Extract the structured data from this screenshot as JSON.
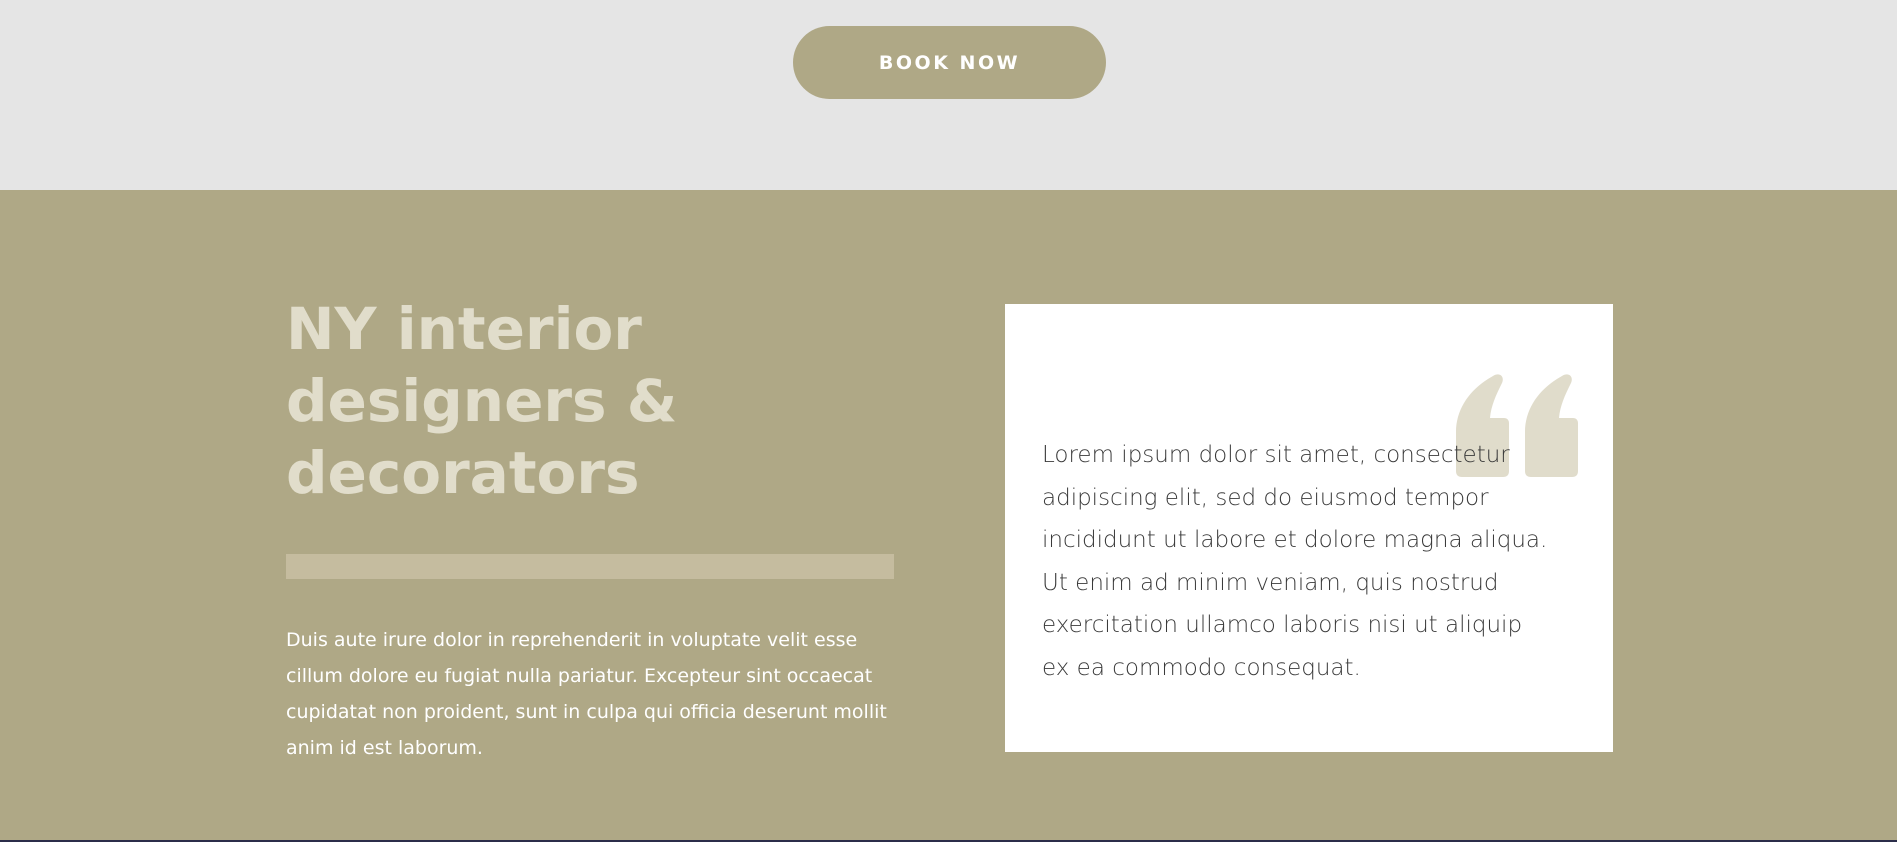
{
  "hero": {
    "book_label": "BOOK NOW"
  },
  "about": {
    "headline_lines": [
      "NY interior",
      "designers &",
      "decorators"
    ],
    "body_lines": [
      "Duis aute irure dolor in reprehenderit in voluptate velit esse",
      "cillum dolore eu fugiat nulla pariatur. Excepteur sint occaecat",
      "cupidatat non proident, sunt in culpa qui officia deserunt mollit",
      "anim id est laborum."
    ]
  },
  "testimonial": {
    "icon": "quote-icon",
    "lines": [
      "Lorem ipsum dolor sit amet, consectetur",
      "adipiscing elit, sed do eiusmod tempor",
      "incididunt ut labore et dolore magna aliqua.",
      "Ut enim ad minim veniam, quis nostrud",
      "exercitation ullamco laboris nisi ut aliquip",
      "ex ea commodo consequat."
    ]
  },
  "colors": {
    "accent": "#afa886",
    "top_background": "#e5e5e5",
    "headline": "#e1ddcb",
    "divider": "#c5bc9f",
    "quote_icon": "#e0dccb",
    "quote_text": "#3a3a3a"
  }
}
